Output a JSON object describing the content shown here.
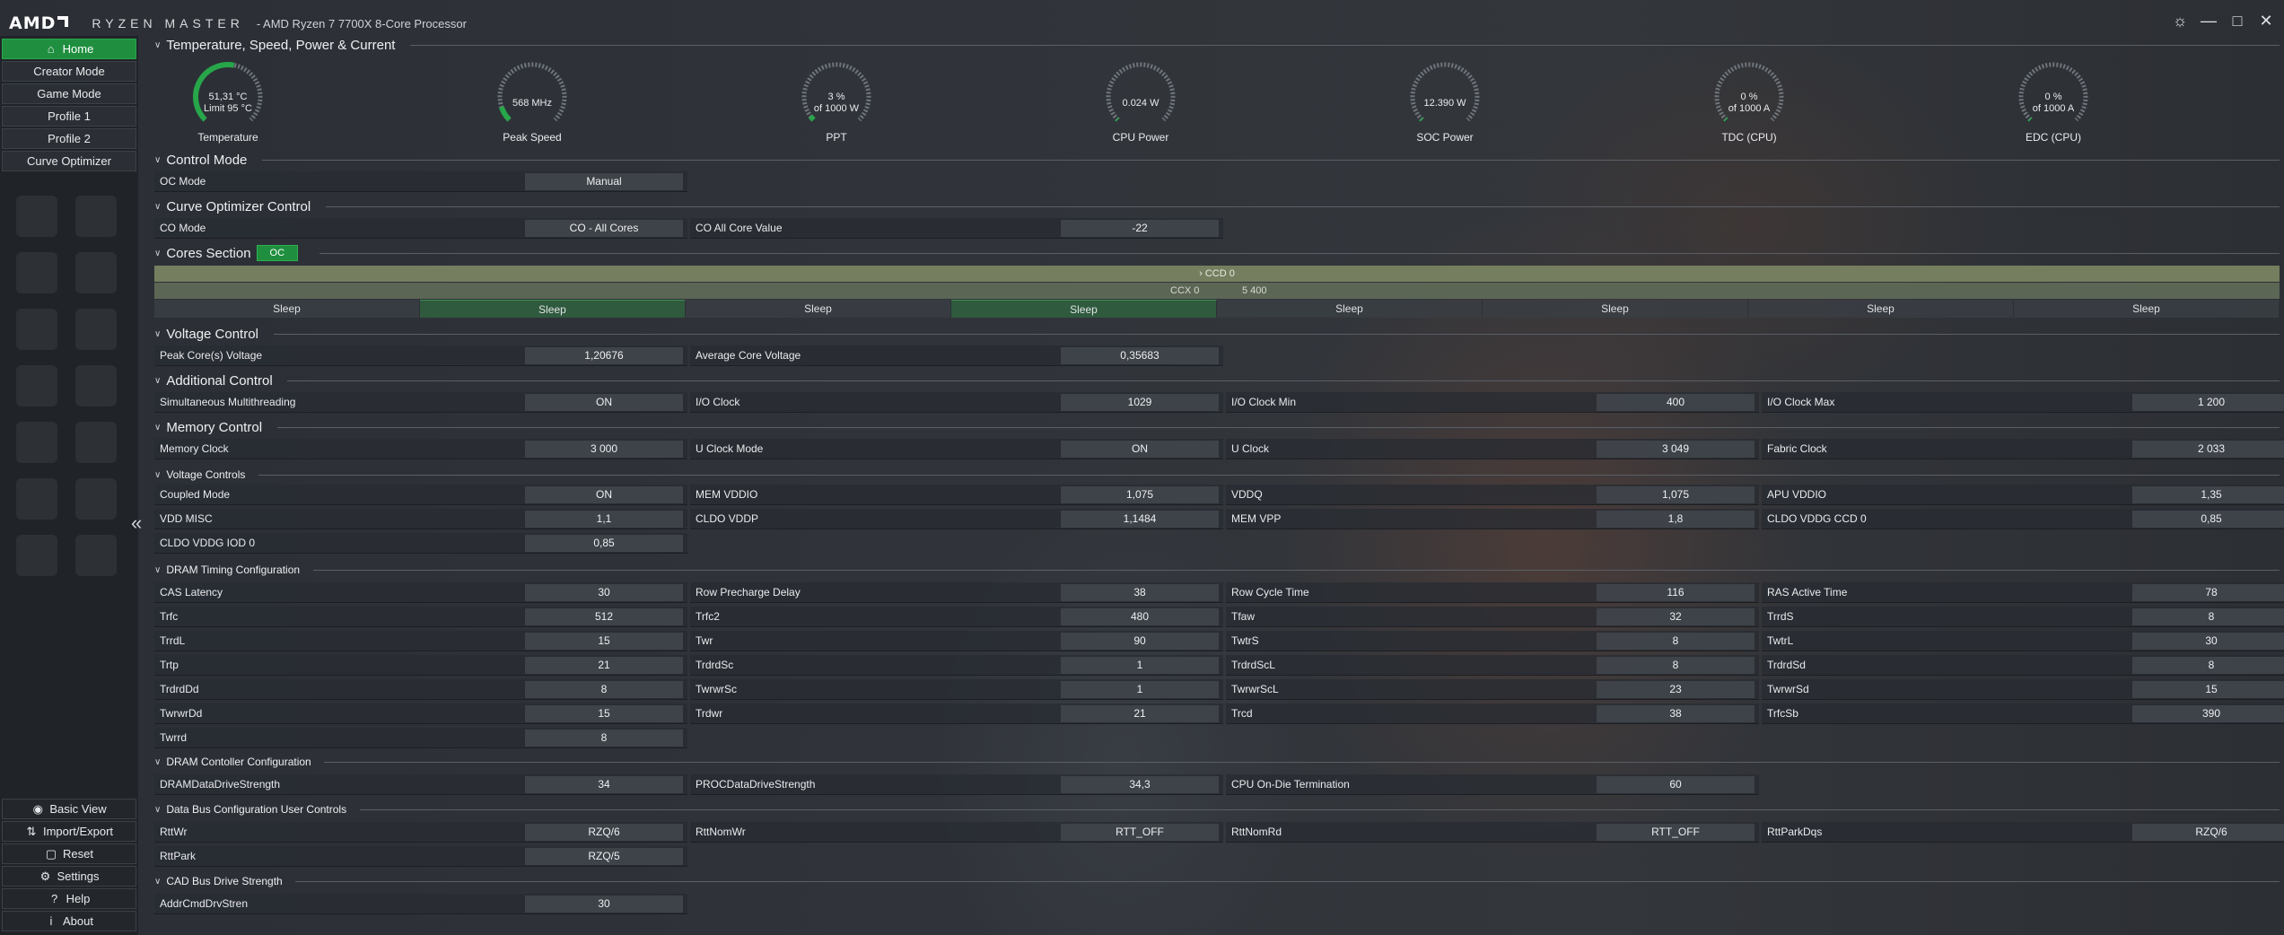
{
  "window": {
    "brand": "AMD",
    "product": "RYZEN MASTER",
    "processor": "- AMD Ryzen 7 7700X 8-Core Processor",
    "controls": [
      "☼",
      "—",
      "□",
      "✕"
    ]
  },
  "sidebar": {
    "items": [
      {
        "label": "Home",
        "icon": "home-icon",
        "active": true
      },
      {
        "label": "Creator Mode"
      },
      {
        "label": "Game Mode"
      },
      {
        "label": "Profile 1"
      },
      {
        "label": "Profile 2"
      },
      {
        "label": "Curve Optimizer"
      }
    ],
    "bottom": [
      {
        "label": "Basic View",
        "icon": "eye-icon",
        "glyph": "◉"
      },
      {
        "label": "Import/Export",
        "icon": "import-export-icon",
        "glyph": "⇅"
      },
      {
        "label": "Reset",
        "icon": "reset-icon",
        "glyph": "▢"
      },
      {
        "label": "Settings",
        "icon": "gear-icon",
        "glyph": "⚙"
      },
      {
        "label": "Help",
        "icon": "help-icon",
        "glyph": "?"
      },
      {
        "label": "About",
        "icon": "info-icon",
        "glyph": "i"
      }
    ],
    "collapse_glyph": "«"
  },
  "sections": {
    "temp": "Temperature, Speed, Power & Current",
    "control_mode": "Control Mode",
    "curve": "Curve Optimizer Control",
    "cores": "Cores Section",
    "cores_badge": "OC",
    "voltage": "Voltage Control",
    "additional": "Additional Control",
    "memory": "Memory Control",
    "volt_controls": "Voltage Controls",
    "dram_timing": "DRAM Timing Configuration",
    "dram_ctrl": "DRAM Contoller Configuration",
    "data_bus": "Data Bus Configuration User Controls",
    "cad_bus": "CAD Bus Drive Strength"
  },
  "gauges": [
    {
      "line1": "51,31 °C",
      "line2": "Limit 95 °C",
      "name": "Temperature",
      "fraction": 0.54,
      "color": "#27a64a"
    },
    {
      "line1": "568  MHz",
      "line2": "",
      "name": "Peak Speed",
      "fraction": 0.1,
      "color": "#27a64a"
    },
    {
      "line1": "3 %",
      "line2": "of 1000 W",
      "name": "PPT",
      "fraction": 0.03,
      "color": "#27a64a"
    },
    {
      "line1": "0.024 W",
      "line2": "",
      "name": "CPU Power",
      "fraction": 0.0,
      "color": "#27a64a"
    },
    {
      "line1": "12.390 W",
      "line2": "",
      "name": "SOC Power",
      "fraction": 0.0,
      "color": "#27a64a"
    },
    {
      "line1": "0 %",
      "line2": "of 1000 A",
      "name": "TDC (CPU)",
      "fraction": 0.0,
      "color": "#27a64a"
    },
    {
      "line1": "0 %",
      "line2": "of 1000 A",
      "name": "EDC (CPU)",
      "fraction": 0.0,
      "color": "#27a64a"
    }
  ],
  "control_mode": {
    "label": "OC Mode",
    "value": "Manual"
  },
  "curve": [
    {
      "label": "CO Mode",
      "value": "CO - All Cores"
    },
    {
      "label": "CO All Core Value",
      "value": "-22"
    }
  ],
  "cores": {
    "ccd": "CCD 0",
    "ccx": "CCX 0",
    "freq": "5 400",
    "chev": "›",
    "states": [
      "Sleep",
      "Sleep",
      "Sleep",
      "Sleep",
      "Sleep",
      "Sleep",
      "Sleep",
      "Sleep"
    ]
  },
  "voltage": [
    {
      "label": "Peak Core(s) Voltage",
      "value": "1,20676"
    },
    {
      "label": "Average Core Voltage",
      "value": "0,35683"
    }
  ],
  "additional": [
    {
      "label": "Simultaneous Multithreading",
      "value": "ON"
    },
    {
      "label": "I/O Clock",
      "value": "1029"
    },
    {
      "label": "I/O Clock Min",
      "value": "400"
    },
    {
      "label": "I/O Clock Max",
      "value": "1 200"
    }
  ],
  "memory": [
    {
      "label": "Memory Clock",
      "value": "3 000"
    },
    {
      "label": "U Clock Mode",
      "value": "ON"
    },
    {
      "label": "U Clock",
      "value": "3 049"
    },
    {
      "label": "Fabric Clock",
      "value": "2 033"
    }
  ],
  "volt_controls": [
    [
      {
        "label": "Coupled Mode",
        "value": "ON"
      },
      {
        "label": "MEM VDDIO",
        "value": "1,075"
      },
      {
        "label": "VDDQ",
        "value": "1,075"
      },
      {
        "label": "APU VDDIO",
        "value": "1,35"
      }
    ],
    [
      {
        "label": "VDD MISC",
        "value": "1,1"
      },
      {
        "label": "CLDO VDDP",
        "value": "1,1484"
      },
      {
        "label": "MEM VPP",
        "value": "1,8"
      },
      {
        "label": "CLDO VDDG CCD 0",
        "value": "0,85"
      }
    ],
    [
      {
        "label": "CLDO VDDG IOD 0",
        "value": "0,85"
      }
    ]
  ],
  "dram_timing": [
    [
      {
        "label": "CAS Latency",
        "value": "30"
      },
      {
        "label": "Row Precharge Delay",
        "value": "38"
      },
      {
        "label": "Row Cycle Time",
        "value": "116"
      },
      {
        "label": "RAS Active Time",
        "value": "78"
      }
    ],
    [
      {
        "label": "Trfc",
        "value": "512"
      },
      {
        "label": "Trfc2",
        "value": "480"
      },
      {
        "label": "Tfaw",
        "value": "32"
      },
      {
        "label": "TrrdS",
        "value": "8"
      }
    ],
    [
      {
        "label": "TrrdL",
        "value": "15"
      },
      {
        "label": "Twr",
        "value": "90"
      },
      {
        "label": "TwtrS",
        "value": "8"
      },
      {
        "label": "TwtrL",
        "value": "30"
      }
    ],
    [
      {
        "label": "Trtp",
        "value": "21"
      },
      {
        "label": "TrdrdSc",
        "value": "1"
      },
      {
        "label": "TrdrdScL",
        "value": "8"
      },
      {
        "label": "TrdrdSd",
        "value": "8"
      }
    ],
    [
      {
        "label": "TrdrdDd",
        "value": "8"
      },
      {
        "label": "TwrwrSc",
        "value": "1"
      },
      {
        "label": "TwrwrScL",
        "value": "23"
      },
      {
        "label": "TwrwrSd",
        "value": "15"
      }
    ],
    [
      {
        "label": "TwrwrDd",
        "value": "15"
      },
      {
        "label": "Trdwr",
        "value": "21"
      },
      {
        "label": "Trcd",
        "value": "38"
      },
      {
        "label": "TrfcSb",
        "value": "390"
      }
    ],
    [
      {
        "label": "Twrrd",
        "value": "8"
      }
    ]
  ],
  "dram_ctrl": [
    {
      "label": "DRAMDataDriveStrength",
      "value": "34"
    },
    {
      "label": "PROCDataDriveStrength",
      "value": "34,3"
    },
    {
      "label": "CPU On-Die Termination",
      "value": "60"
    }
  ],
  "data_bus": [
    [
      {
        "label": "RttWr",
        "value": "RZQ/6"
      },
      {
        "label": "RttNomWr",
        "value": "RTT_OFF"
      },
      {
        "label": "RttNomRd",
        "value": "RTT_OFF"
      },
      {
        "label": "RttParkDqs",
        "value": "RZQ/6"
      }
    ],
    [
      {
        "label": "RttPark",
        "value": "RZQ/5"
      }
    ]
  ],
  "cad_bus": {
    "label": "AddrCmdDrvStren",
    "value": "30"
  }
}
